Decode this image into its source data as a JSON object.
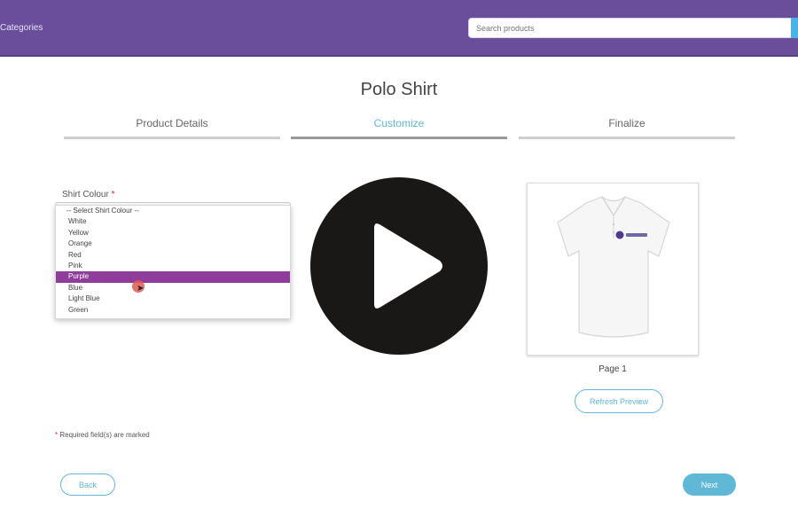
{
  "header": {
    "categories_label": "Categories",
    "search_placeholder": "Search products"
  },
  "page": {
    "title": "Polo Shirt"
  },
  "steps": [
    {
      "label": "Product Details",
      "active": false
    },
    {
      "label": "Customize",
      "active": true
    },
    {
      "label": "Finalize",
      "active": false
    }
  ],
  "form": {
    "shirt_colour_label": "Shirt Colour",
    "required_marker": "*",
    "options": [
      "-- Select Shirt Colour --",
      "White",
      "Yellow",
      "Orange",
      "Red",
      "Pink",
      "Purple",
      "Blue",
      "Light Blue",
      "Green"
    ],
    "selected_option": "Purple",
    "required_note": "Required field(s) are marked"
  },
  "preview": {
    "page_label": "Page 1",
    "refresh_label": "Refresh Preview"
  },
  "nav": {
    "back_label": "Back",
    "next_label": "Next"
  },
  "colors": {
    "header_bg": "#6b4e9b",
    "accent": "#5fb8d6",
    "selected_option": "#8e3d9b",
    "play_overlay": "#1a1717"
  },
  "icons": {
    "play": "play-icon",
    "search": "search-icon"
  }
}
